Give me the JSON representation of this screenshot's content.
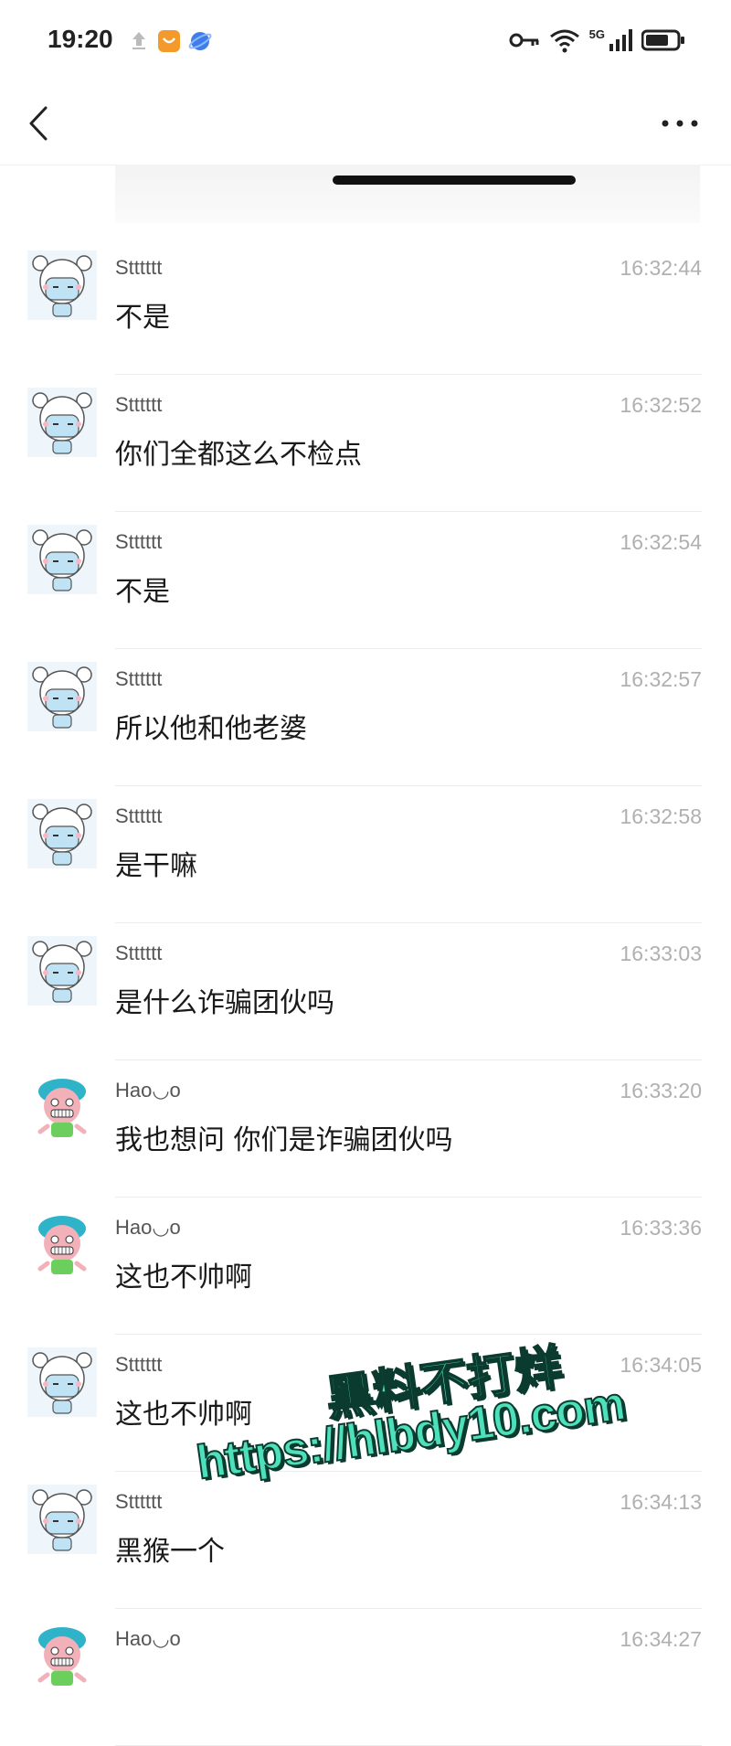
{
  "status_bar": {
    "time": "19:20",
    "network": "5G",
    "left_icons": [
      "upload-icon",
      "app-notification-icon",
      "browser-icon"
    ],
    "right_icons": [
      "key-icon",
      "wifi-icon",
      "cellular-signal-icon",
      "battery-icon"
    ]
  },
  "nav": {
    "back_icon": "chevron-left-icon",
    "more_icon": "more-horizontal-icon"
  },
  "messages": [
    {
      "sender": "Stttttt",
      "time": "16:32:44",
      "text": "不是",
      "avatar": "bear-avatar"
    },
    {
      "sender": "Stttttt",
      "time": "16:32:52",
      "text": "你们全都这么不检点",
      "avatar": "bear-avatar"
    },
    {
      "sender": "Stttttt",
      "time": "16:32:54",
      "text": "不是",
      "avatar": "bear-avatar"
    },
    {
      "sender": "Stttttt",
      "time": "16:32:57",
      "text": "所以他和他老婆",
      "avatar": "bear-avatar"
    },
    {
      "sender": "Stttttt",
      "time": "16:32:58",
      "text": "是干嘛",
      "avatar": "bear-avatar"
    },
    {
      "sender": "Stttttt",
      "time": "16:33:03",
      "text": "是什么诈骗团伙吗",
      "avatar": "bear-avatar"
    },
    {
      "sender": "Hao◡o",
      "time": "16:33:20",
      "text": "我也想问 你们是诈骗团伙吗",
      "avatar": "cartoon-avatar"
    },
    {
      "sender": "Hao◡o",
      "time": "16:33:36",
      "text": "这也不帅啊",
      "avatar": "cartoon-avatar"
    },
    {
      "sender": "Stttttt",
      "time": "16:34:05",
      "text": "这也不帅啊",
      "avatar": "bear-avatar"
    },
    {
      "sender": "Stttttt",
      "time": "16:34:13",
      "text": "黑猴一个",
      "avatar": "bear-avatar"
    },
    {
      "sender": "Hao◡o",
      "time": "16:34:27",
      "text": "",
      "avatar": "cartoon-avatar"
    }
  ],
  "watermark": {
    "line1": "黑料不打烊",
    "line2": "https://hlbdy10.com"
  },
  "colors": {
    "watermark_fill": "#4de0bb",
    "watermark_stroke": "#0b3b2f",
    "timestamp": "#b0b0b0"
  }
}
